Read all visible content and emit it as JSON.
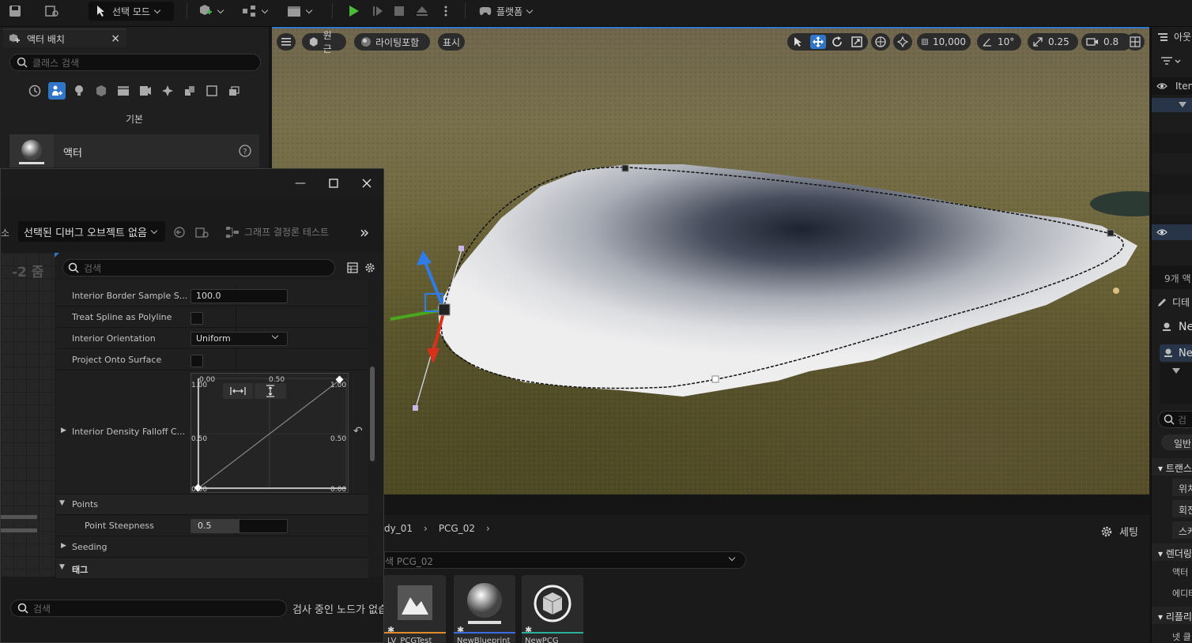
{
  "toolbar": {
    "select_mode": "선택 모드",
    "platform": "플랫폼"
  },
  "place_actors": {
    "tab_title": "액터 배치",
    "search_placeholder": "클래스 검색",
    "category_label": "기본",
    "item_label": "액터"
  },
  "viewport": {
    "perspective": "원근",
    "lighting": "라이팅포함",
    "show": "표시",
    "grid_snap": "10,000",
    "rotation_snap": "10°",
    "scale_snap": "0.25",
    "camera_speed": "0.8"
  },
  "outliner": {
    "title": "아웃",
    "item_col": "Item",
    "count": "9개 액",
    "details": "디테",
    "ne1": "Ne",
    "ne2": "Ne",
    "search": "검",
    "general": "일반",
    "transform": "트랜스",
    "location": "위치",
    "rotation": "회전",
    "scale": "스케",
    "rendering": "렌더링",
    "actor_hidden": "액터 ",
    "editor": "에디터",
    "replication": "리플리",
    "net": "넷 클"
  },
  "pcg": {
    "debug_object": "선택된 디버그 오브젝트 없음",
    "graph_test": "그래프 결정론 테스트",
    "left_frag": "소",
    "zoom_label": "-2 줌",
    "props_search": "검색",
    "props": {
      "border_sample_label": "Interior Border Sample S...",
      "border_sample_value": "100.0",
      "treat_spline_label": "Treat Spline as Polyline",
      "orientation_label": "Interior Orientation",
      "orientation_value": "Uniform",
      "project_label": "Project Onto Surface",
      "falloff_label": "Interior Density Falloff C...",
      "points_section": "Points",
      "steepness_label": "Point Steepness",
      "steepness_value": "0.5",
      "steepness_fraction": 0.5,
      "seeding_label": "Seeding",
      "tags_section": "태그"
    },
    "curve": {
      "x_min": "0.00",
      "x_mid": "0.50",
      "x_max": "0.00",
      "y_top_left": "1.00",
      "y_top_right": "1.00",
      "y_mid_left": "0.50",
      "y_mid_right": "0.50",
      "y_bot_left": "0.00",
      "y_bot_right": "0.00"
    },
    "bottom_search": "검색",
    "inspecting": "검사 중인 노드가 없습"
  },
  "content": {
    "crumb1": "dy_01",
    "crumb2": "PCG_02",
    "settings": "세팅",
    "search_value": "색 PCG_02",
    "assets": [
      {
        "label": "LV_PCGTest",
        "color": "#e08a2a"
      },
      {
        "label": "NewBlueprint",
        "color": "#3b6be0"
      },
      {
        "label": "NewPCG",
        "color": "#2ab09a"
      }
    ]
  }
}
